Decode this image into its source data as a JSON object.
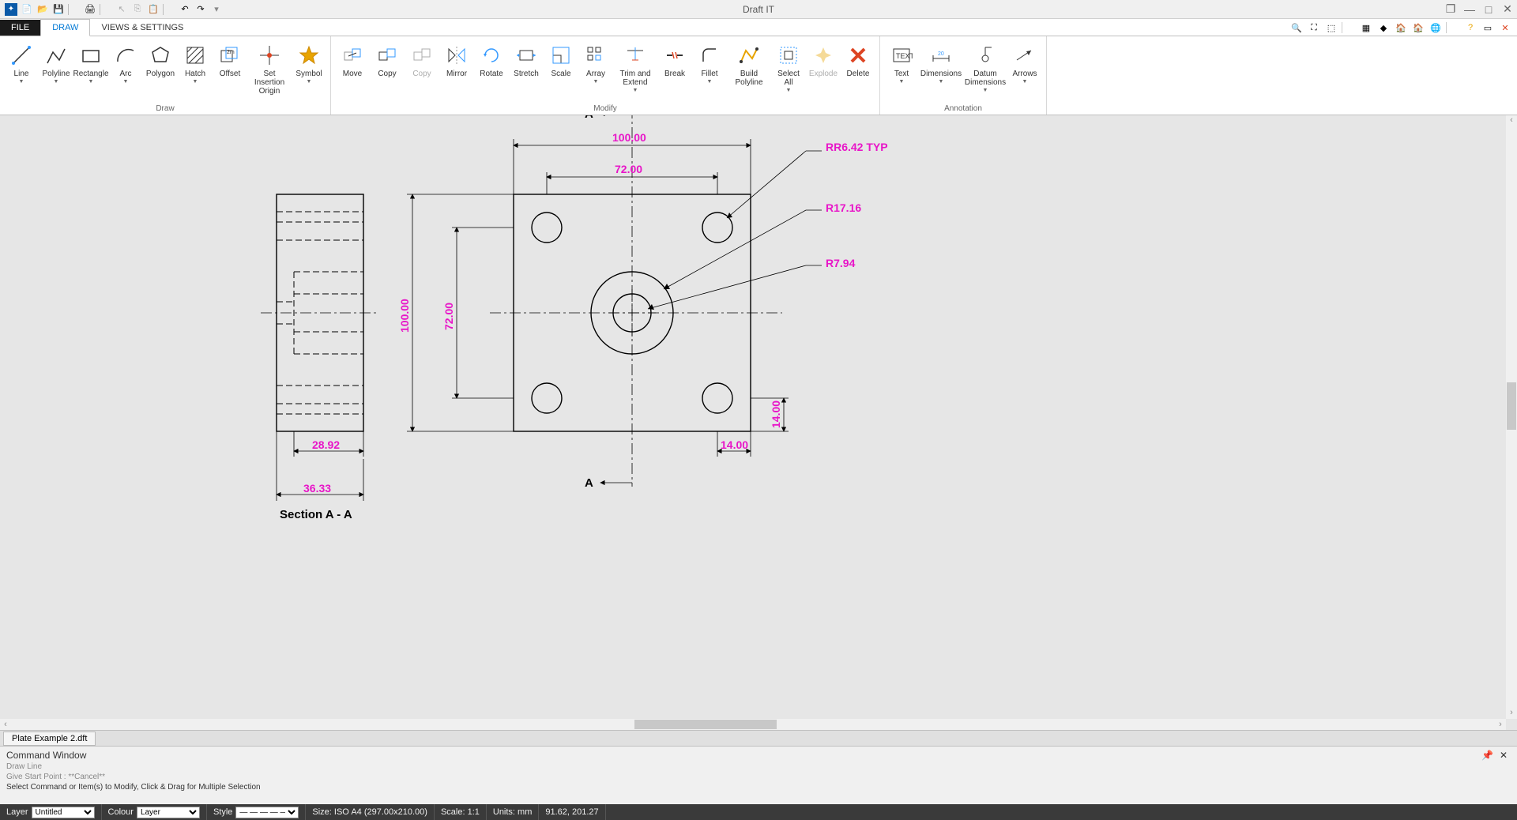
{
  "app": {
    "title": "Draft IT"
  },
  "qat": {
    "items": [
      "logo",
      "new",
      "open",
      "save",
      "print",
      "sep",
      "select",
      "copy",
      "paste",
      "sep",
      "undo",
      "redo",
      "more"
    ]
  },
  "win_controls": {
    "restore": "❐",
    "min": "—",
    "max": "□",
    "close": "✕"
  },
  "tabs": {
    "file": "FILE",
    "draw": "DRAW",
    "views": "VIEWS & SETTINGS"
  },
  "ribbon_right_icons": [
    "zoom-in",
    "zoom-extents",
    "zoom-window",
    "grid",
    "snap",
    "home-yellow",
    "home-blue",
    "globe",
    "help",
    "minimize-ribbon",
    "close-doc"
  ],
  "ribbon": {
    "groups": [
      {
        "label": "Draw",
        "items": [
          {
            "name": "line",
            "label": "Line",
            "drop": true
          },
          {
            "name": "polyline",
            "label": "Polyline",
            "drop": true
          },
          {
            "name": "rectangle",
            "label": "Rectangle",
            "drop": true
          },
          {
            "name": "arc",
            "label": "Arc",
            "drop": true
          },
          {
            "name": "polygon",
            "label": "Polygon"
          },
          {
            "name": "hatch",
            "label": "Hatch",
            "drop": true
          },
          {
            "name": "offset",
            "label": "Offset"
          },
          {
            "name": "set-insertion-origin",
            "label": "Set Insertion Origin",
            "wide": true
          },
          {
            "name": "symbol",
            "label": "Symbol",
            "drop": true
          }
        ]
      },
      {
        "label": "Modify",
        "items": [
          {
            "name": "move",
            "label": "Move"
          },
          {
            "name": "copy",
            "label": "Copy"
          },
          {
            "name": "copy2",
            "label": "Copy",
            "disabled": true
          },
          {
            "name": "mirror",
            "label": "Mirror"
          },
          {
            "name": "rotate",
            "label": "Rotate"
          },
          {
            "name": "stretch",
            "label": "Stretch"
          },
          {
            "name": "scale",
            "label": "Scale"
          },
          {
            "name": "array",
            "label": "Array",
            "drop": true
          },
          {
            "name": "trim-extend",
            "label": "Trim and Extend",
            "drop": true,
            "wide": true
          },
          {
            "name": "break",
            "label": "Break"
          },
          {
            "name": "fillet",
            "label": "Fillet",
            "drop": true
          },
          {
            "name": "build-polyline",
            "label": "Build Polyline",
            "wide": true
          },
          {
            "name": "select-all",
            "label": "Select All",
            "drop": true
          },
          {
            "name": "explode",
            "label": "Explode",
            "disabled": true
          },
          {
            "name": "delete",
            "label": "Delete"
          }
        ]
      },
      {
        "label": "Annotation",
        "items": [
          {
            "name": "text",
            "label": "Text",
            "drop": true
          },
          {
            "name": "dimensions",
            "label": "Dimensions",
            "drop": true,
            "wide": true
          },
          {
            "name": "datum-dimensions",
            "label": "Datum Dimensions",
            "drop": true,
            "wide": true
          },
          {
            "name": "arrows",
            "label": "Arrows",
            "drop": true
          }
        ]
      }
    ]
  },
  "drawing": {
    "section_label": "Section A - A",
    "section_mark_top": "A",
    "section_mark_bottom": "A",
    "dims": {
      "d100w": "100.00",
      "d72w": "72.00",
      "d100h": "100.00",
      "d72h": "72.00",
      "d14w": "14.00",
      "d14h": "14.00",
      "d2892": "28.92",
      "d3633": "36.33"
    },
    "callouts": {
      "rr642": "RR6.42 TYP",
      "r1716": "R17.16",
      "r794": "R7.94"
    }
  },
  "doc_tab": "Plate Example 2.dft",
  "cmd": {
    "title": "Command Window",
    "l1": "Draw Line",
    "l2": "Give Start Point :   **Cancel**",
    "l3": "Select Command or Item(s) to Modify, Click & Drag for Multiple Selection"
  },
  "status": {
    "layer_label": "Layer",
    "layer_value": "Untitled",
    "colour_label": "Colour",
    "colour_value": "Layer",
    "style_label": "Style",
    "style_value": "— — — — — —",
    "size": "Size: ISO A4 (297.00x210.00)",
    "scale": "Scale: 1:1",
    "units": "Units: mm",
    "coords": "91.62, 201.27"
  }
}
